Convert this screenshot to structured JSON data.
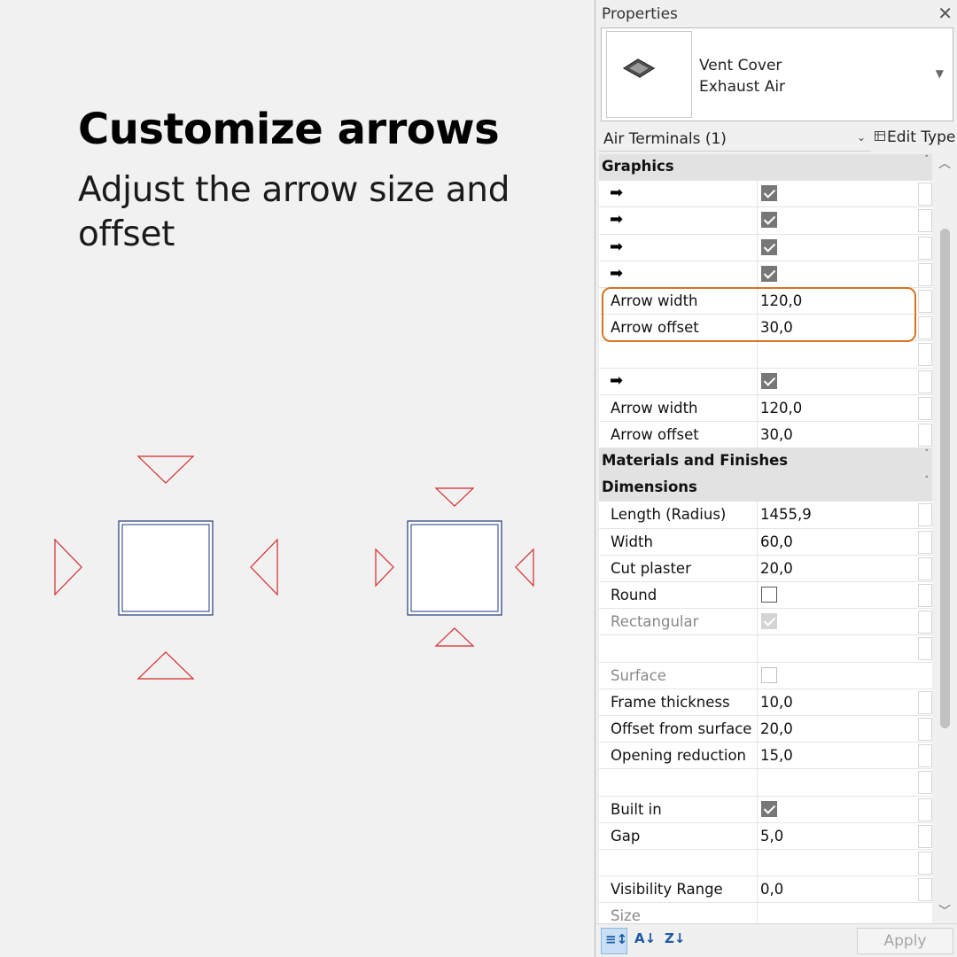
{
  "hero": {
    "title": "Customize arrows",
    "subtitle": "Adjust the arrow size and offset"
  },
  "properties": {
    "title": "Properties",
    "type_name_line1": "Vent Cover",
    "type_name_line2": "Exhaust Air",
    "filter_label": "Air Terminals (1)",
    "edit_type_label": "Edit Type",
    "apply_label": "Apply",
    "sections": {
      "graphics": "Graphics",
      "materials": "Materials and Finishes",
      "dimensions": "Dimensions"
    },
    "graphics_rows": [
      {
        "arrow": "➡",
        "checked": true
      },
      {
        "arrow": "➡",
        "checked": true
      },
      {
        "arrow": "➡",
        "checked": true
      },
      {
        "arrow": "➡",
        "checked": true
      }
    ],
    "arrow_width_1": {
      "label": "Arrow width",
      "value": "120,0"
    },
    "arrow_offset_1": {
      "label": "Arrow offset",
      "value": "30,0"
    },
    "graphics_row_5": {
      "arrow": "➡",
      "checked": true
    },
    "arrow_width_2": {
      "label": "Arrow width",
      "value": "120,0"
    },
    "arrow_offset_2": {
      "label": "Arrow offset",
      "value": "30,0"
    },
    "dimensions": {
      "length": {
        "label": "Length (Radius)",
        "value": "1455,9"
      },
      "width": {
        "label": "Width",
        "value": "60,0"
      },
      "cut_plaster": {
        "label": "Cut plaster",
        "value": "20,0"
      },
      "round": {
        "label": "Round",
        "checked": false
      },
      "rectangular": {
        "label": "Rectangular",
        "checked": true
      },
      "surface": {
        "label": "Surface",
        "checked": false
      },
      "frame_thickness": {
        "label": "Frame thickness",
        "value": "10,0"
      },
      "offset_from_surface": {
        "label": "Offset from surface",
        "value": "20,0"
      },
      "opening_reduction": {
        "label": "Opening reduction",
        "value": "15,0"
      },
      "built_in": {
        "label": "Built in",
        "checked": true
      },
      "gap": {
        "label": "Gap",
        "value": "5,0"
      },
      "visibility_range": {
        "label": "Visibility Range",
        "value": "0,0"
      },
      "size": {
        "label": "Size"
      }
    }
  },
  "colors": {
    "highlight": "#d9731f",
    "arrow_red": "#d42a2a",
    "square_blue": "#1f3a7a"
  }
}
